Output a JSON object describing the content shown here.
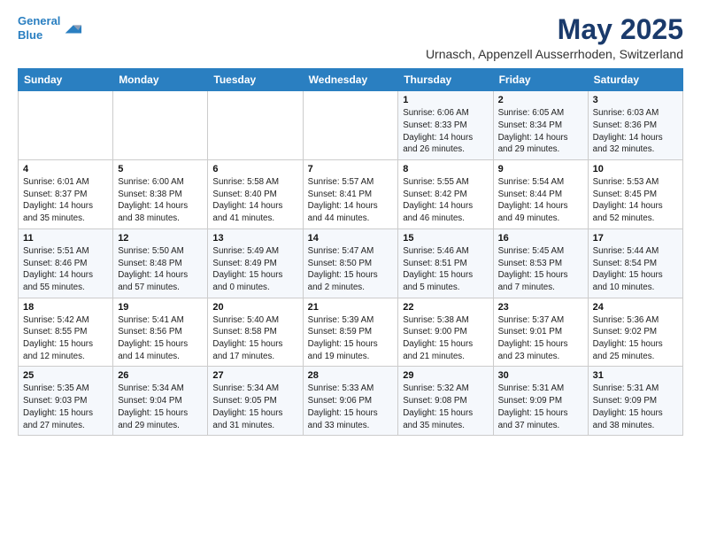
{
  "header": {
    "logo_line1": "General",
    "logo_line2": "Blue",
    "title": "May 2025",
    "subtitle": "Urnasch, Appenzell Ausserrhoden, Switzerland"
  },
  "days_of_week": [
    "Sunday",
    "Monday",
    "Tuesday",
    "Wednesday",
    "Thursday",
    "Friday",
    "Saturday"
  ],
  "weeks": [
    [
      {
        "day": "",
        "info": ""
      },
      {
        "day": "",
        "info": ""
      },
      {
        "day": "",
        "info": ""
      },
      {
        "day": "",
        "info": ""
      },
      {
        "day": "1",
        "info": "Sunrise: 6:06 AM\nSunset: 8:33 PM\nDaylight: 14 hours\nand 26 minutes."
      },
      {
        "day": "2",
        "info": "Sunrise: 6:05 AM\nSunset: 8:34 PM\nDaylight: 14 hours\nand 29 minutes."
      },
      {
        "day": "3",
        "info": "Sunrise: 6:03 AM\nSunset: 8:36 PM\nDaylight: 14 hours\nand 32 minutes."
      }
    ],
    [
      {
        "day": "4",
        "info": "Sunrise: 6:01 AM\nSunset: 8:37 PM\nDaylight: 14 hours\nand 35 minutes."
      },
      {
        "day": "5",
        "info": "Sunrise: 6:00 AM\nSunset: 8:38 PM\nDaylight: 14 hours\nand 38 minutes."
      },
      {
        "day": "6",
        "info": "Sunrise: 5:58 AM\nSunset: 8:40 PM\nDaylight: 14 hours\nand 41 minutes."
      },
      {
        "day": "7",
        "info": "Sunrise: 5:57 AM\nSunset: 8:41 PM\nDaylight: 14 hours\nand 44 minutes."
      },
      {
        "day": "8",
        "info": "Sunrise: 5:55 AM\nSunset: 8:42 PM\nDaylight: 14 hours\nand 46 minutes."
      },
      {
        "day": "9",
        "info": "Sunrise: 5:54 AM\nSunset: 8:44 PM\nDaylight: 14 hours\nand 49 minutes."
      },
      {
        "day": "10",
        "info": "Sunrise: 5:53 AM\nSunset: 8:45 PM\nDaylight: 14 hours\nand 52 minutes."
      }
    ],
    [
      {
        "day": "11",
        "info": "Sunrise: 5:51 AM\nSunset: 8:46 PM\nDaylight: 14 hours\nand 55 minutes."
      },
      {
        "day": "12",
        "info": "Sunrise: 5:50 AM\nSunset: 8:48 PM\nDaylight: 14 hours\nand 57 minutes."
      },
      {
        "day": "13",
        "info": "Sunrise: 5:49 AM\nSunset: 8:49 PM\nDaylight: 15 hours\nand 0 minutes."
      },
      {
        "day": "14",
        "info": "Sunrise: 5:47 AM\nSunset: 8:50 PM\nDaylight: 15 hours\nand 2 minutes."
      },
      {
        "day": "15",
        "info": "Sunrise: 5:46 AM\nSunset: 8:51 PM\nDaylight: 15 hours\nand 5 minutes."
      },
      {
        "day": "16",
        "info": "Sunrise: 5:45 AM\nSunset: 8:53 PM\nDaylight: 15 hours\nand 7 minutes."
      },
      {
        "day": "17",
        "info": "Sunrise: 5:44 AM\nSunset: 8:54 PM\nDaylight: 15 hours\nand 10 minutes."
      }
    ],
    [
      {
        "day": "18",
        "info": "Sunrise: 5:42 AM\nSunset: 8:55 PM\nDaylight: 15 hours\nand 12 minutes."
      },
      {
        "day": "19",
        "info": "Sunrise: 5:41 AM\nSunset: 8:56 PM\nDaylight: 15 hours\nand 14 minutes."
      },
      {
        "day": "20",
        "info": "Sunrise: 5:40 AM\nSunset: 8:58 PM\nDaylight: 15 hours\nand 17 minutes."
      },
      {
        "day": "21",
        "info": "Sunrise: 5:39 AM\nSunset: 8:59 PM\nDaylight: 15 hours\nand 19 minutes."
      },
      {
        "day": "22",
        "info": "Sunrise: 5:38 AM\nSunset: 9:00 PM\nDaylight: 15 hours\nand 21 minutes."
      },
      {
        "day": "23",
        "info": "Sunrise: 5:37 AM\nSunset: 9:01 PM\nDaylight: 15 hours\nand 23 minutes."
      },
      {
        "day": "24",
        "info": "Sunrise: 5:36 AM\nSunset: 9:02 PM\nDaylight: 15 hours\nand 25 minutes."
      }
    ],
    [
      {
        "day": "25",
        "info": "Sunrise: 5:35 AM\nSunset: 9:03 PM\nDaylight: 15 hours\nand 27 minutes."
      },
      {
        "day": "26",
        "info": "Sunrise: 5:34 AM\nSunset: 9:04 PM\nDaylight: 15 hours\nand 29 minutes."
      },
      {
        "day": "27",
        "info": "Sunrise: 5:34 AM\nSunset: 9:05 PM\nDaylight: 15 hours\nand 31 minutes."
      },
      {
        "day": "28",
        "info": "Sunrise: 5:33 AM\nSunset: 9:06 PM\nDaylight: 15 hours\nand 33 minutes."
      },
      {
        "day": "29",
        "info": "Sunrise: 5:32 AM\nSunset: 9:08 PM\nDaylight: 15 hours\nand 35 minutes."
      },
      {
        "day": "30",
        "info": "Sunrise: 5:31 AM\nSunset: 9:09 PM\nDaylight: 15 hours\nand 37 minutes."
      },
      {
        "day": "31",
        "info": "Sunrise: 5:31 AM\nSunset: 9:09 PM\nDaylight: 15 hours\nand 38 minutes."
      }
    ]
  ]
}
